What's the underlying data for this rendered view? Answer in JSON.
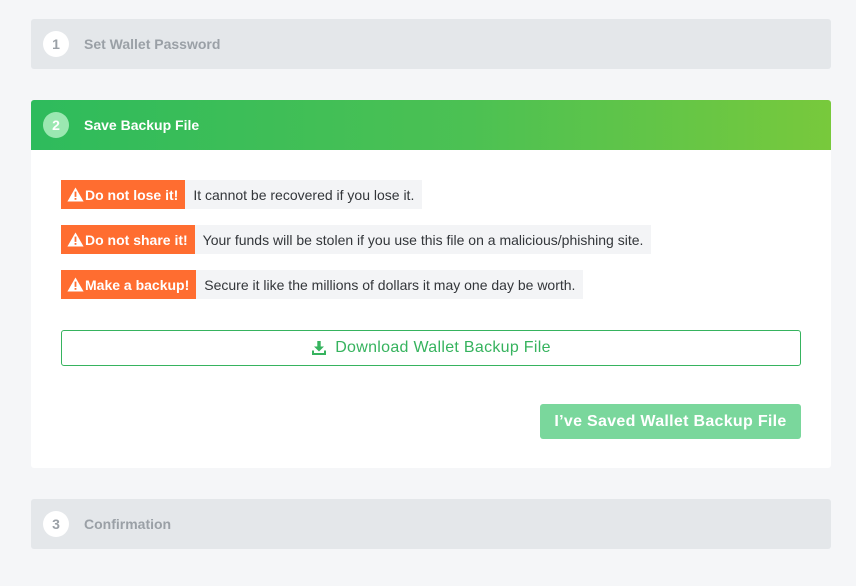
{
  "steps": [
    {
      "number": "1",
      "title": "Set Wallet Password",
      "state": "inactive"
    },
    {
      "number": "2",
      "title": "Save Backup File",
      "state": "active"
    },
    {
      "number": "3",
      "title": "Confirmation",
      "state": "inactive"
    }
  ],
  "warnings": [
    {
      "badge": "Do not lose it!",
      "text": "It cannot be recovered if you lose it.",
      "icon": "warning-icon"
    },
    {
      "badge": "Do not share it!",
      "text": "Your funds will be stolen if you use this file on a malicious/phishing site.",
      "icon": "warning-icon"
    },
    {
      "badge": "Make a backup!",
      "text": "Secure it like the millions of dollars it may one day be worth.",
      "icon": "warning-icon"
    }
  ],
  "actions": {
    "download_label": "Download Wallet Backup File",
    "download_icon": "download-icon",
    "saved_label": "I’ve Saved Wallet Backup File"
  },
  "colors": {
    "accent_green": "#36b35e",
    "warning_orange": "#ff6d30",
    "header_gradient_start": "#2ebb5c",
    "header_gradient_end": "#78c93c"
  }
}
